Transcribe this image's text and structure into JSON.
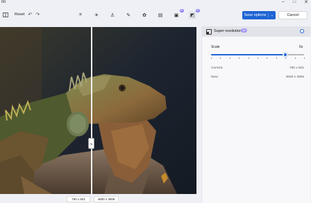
{
  "app": {
    "title": "ito"
  },
  "window_controls": {
    "minimize": "–",
    "maximize": "□",
    "close": "✕"
  },
  "toolbar": {
    "reset_label": "Reset",
    "undo_glyph": "↶",
    "redo_glyph": "↷",
    "tools": [
      {
        "name": "crop-icon",
        "glyph": "⌗",
        "active": false
      },
      {
        "name": "adjust-icon",
        "glyph": "☀",
        "active": false
      },
      {
        "name": "erase-icon",
        "glyph": "♙",
        "active": false
      },
      {
        "name": "draw-icon",
        "glyph": "✎",
        "active": false
      },
      {
        "name": "filter-icon",
        "glyph": "✿",
        "active": false
      },
      {
        "name": "markup-icon",
        "glyph": "▤",
        "active": false
      },
      {
        "name": "background-icon",
        "glyph": "▣",
        "active": false,
        "badge": "AI"
      },
      {
        "name": "super-resolution-icon",
        "glyph": "◩",
        "active": true,
        "badge": "AI"
      }
    ],
    "save_label": "Save options",
    "save_chevron": "⌄",
    "cancel_label": "Cancel"
  },
  "canvas": {
    "handle_glyph": "⇆"
  },
  "dimensions": {
    "before": "750 x 501",
    "after": "4500 x 3006"
  },
  "panel": {
    "title": "Super resolution",
    "ai_badge": "AI",
    "scale_label": "Scale",
    "scale_value": "6x",
    "scale_fraction": 0.8,
    "tick_count": 11,
    "current_label": "Current:",
    "current_value": "750 x 501",
    "new_label": "New:",
    "new_value": "4500 x 3006"
  },
  "colors": {
    "accent": "#1e64d4",
    "ai_badge": "#a89bf5"
  }
}
